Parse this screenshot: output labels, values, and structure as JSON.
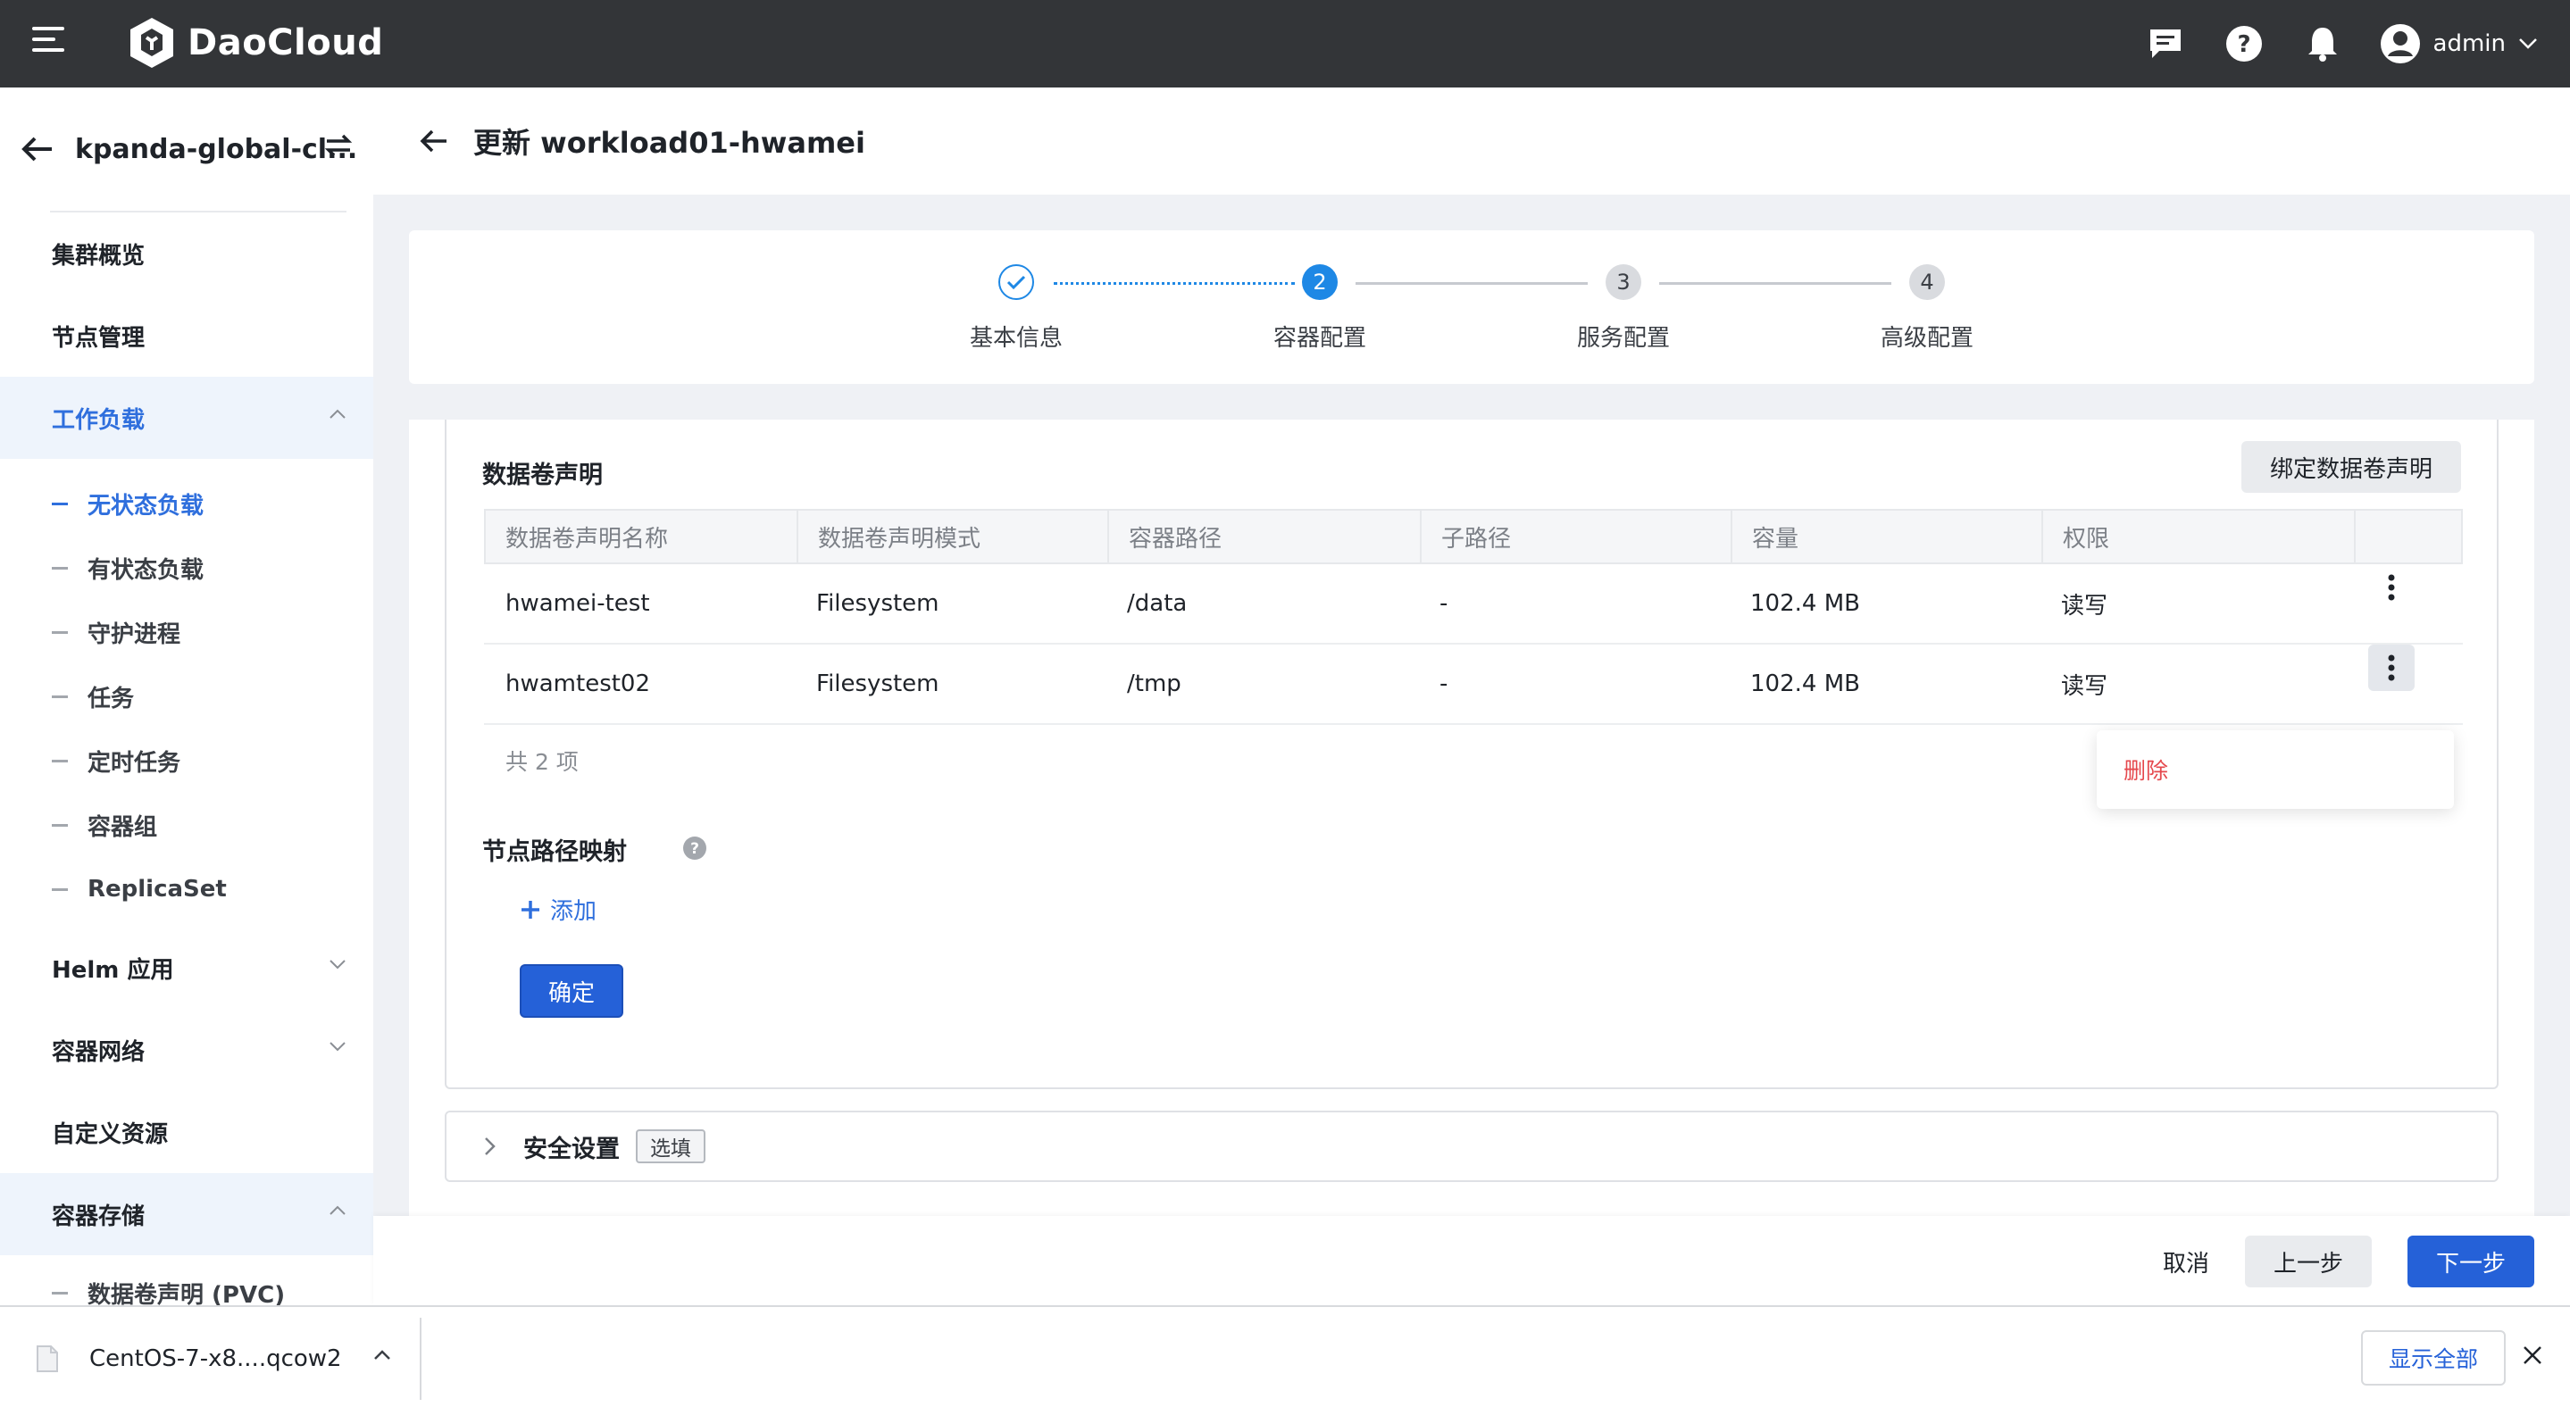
{
  "topbar": {
    "brand": "DaoCloud",
    "user_name": "admin"
  },
  "sidebar": {
    "cluster_name": "kpanda-global-cl...",
    "items": [
      {
        "label": "集群概览"
      },
      {
        "label": "节点管理"
      },
      {
        "label": "工作负载",
        "expanded": true,
        "active": true
      },
      {
        "label": "Helm 应用",
        "expanded": false
      },
      {
        "label": "容器网络",
        "expanded": false
      },
      {
        "label": "自定义资源"
      },
      {
        "label": "容器存储",
        "expanded": true
      }
    ],
    "workload_sub": [
      {
        "label": "无状态负载",
        "active": true
      },
      {
        "label": "有状态负载"
      },
      {
        "label": "守护进程"
      },
      {
        "label": "任务"
      },
      {
        "label": "定时任务"
      },
      {
        "label": "容器组"
      },
      {
        "label": "ReplicaSet"
      }
    ],
    "storage_sub": [
      {
        "label": "数据卷声明 (PVC)"
      }
    ]
  },
  "page": {
    "title": "更新 workload01-hwamei"
  },
  "stepper": {
    "steps": [
      {
        "number": "1",
        "label": "基本信息",
        "status": "done"
      },
      {
        "number": "2",
        "label": "容器配置",
        "status": "current"
      },
      {
        "number": "3",
        "label": "服务配置",
        "status": "pending"
      },
      {
        "number": "4",
        "label": "高级配置",
        "status": "pending"
      }
    ]
  },
  "pvc": {
    "title": "数据卷声明",
    "bind_button": "绑定数据卷声明",
    "columns": [
      "数据卷声明名称",
      "数据卷声明模式",
      "容器路径",
      "子路径",
      "容量",
      "权限"
    ],
    "rows": [
      {
        "name": "hwamei-test",
        "mode": "Filesystem",
        "path": "/data",
        "subpath": "-",
        "capacity": "102.4 MB",
        "permission": "读写"
      },
      {
        "name": "hwamtest02",
        "mode": "Filesystem",
        "path": "/tmp",
        "subpath": "-",
        "capacity": "102.4 MB",
        "permission": "读写"
      }
    ],
    "total": "共 2 项",
    "row_menu": {
      "delete": "删除"
    }
  },
  "host_path": {
    "title": "节点路径映射",
    "add_label": "添加",
    "confirm_label": "确定"
  },
  "security": {
    "title": "安全设置",
    "tag": "选填"
  },
  "footer": {
    "cancel": "取消",
    "prev": "上一步",
    "next": "下一步"
  },
  "download_bar": {
    "file_name": "CentOS-7-x8....qcow2",
    "show_all": "显示全部"
  },
  "colors": {
    "primary": "#2561d8",
    "step_active": "#1e88e5",
    "danger": "#e5484d",
    "topbar": "#333538"
  }
}
